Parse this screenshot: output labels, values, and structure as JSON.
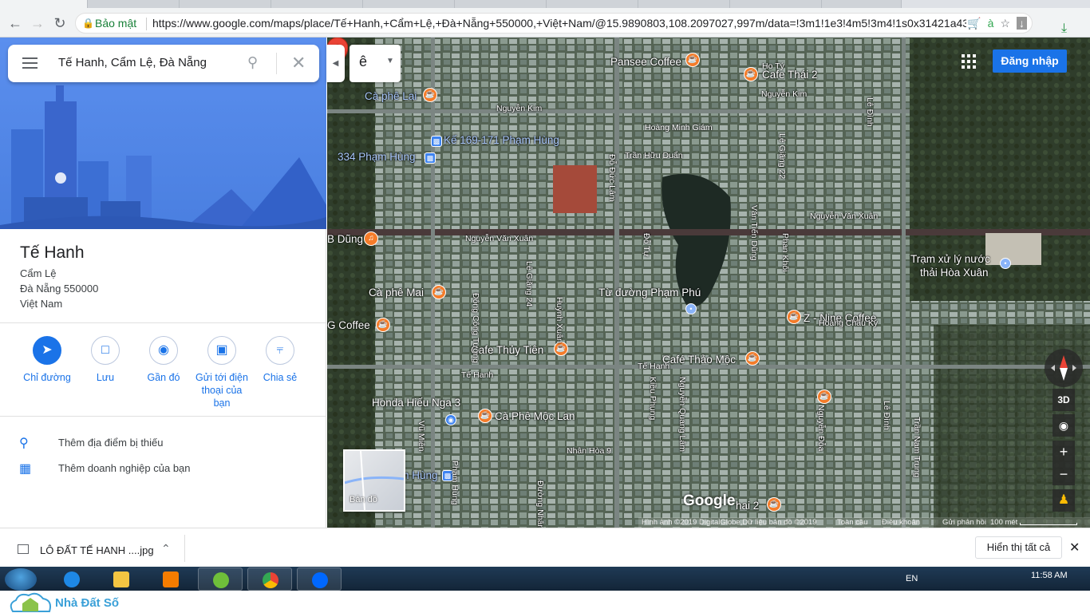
{
  "browser": {
    "secure_label": "Bảo mật",
    "url": "https://www.google.com/maps/place/Tế+Hanh,+Cẩm+Lệ,+Đà+Nẵng+550000,+Việt+Nam/@15.9890803,108.2097027,997m/data=!3m1!1e3!4m5!3m4!1s0x31421a4317"
  },
  "search": {
    "query": "Tế Hanh, Cẩm Lệ, Đà Nẵng"
  },
  "place": {
    "name": "Tế Hanh",
    "address_lines": [
      "Cẩm Lệ",
      "Đà Nẵng 550000",
      "Việt Nam"
    ]
  },
  "actions": [
    {
      "label": "Chỉ đường",
      "icon": "directions-icon"
    },
    {
      "label": "Lưu",
      "icon": "bookmark-icon"
    },
    {
      "label": "Gần đó",
      "icon": "nearby-icon"
    },
    {
      "label": "Gửi tới điện thoại của bạn",
      "icon": "send-to-phone-icon"
    },
    {
      "label": "Chia sẻ",
      "icon": "share-icon"
    }
  ],
  "extras": [
    {
      "label": "Thêm địa điểm bị thiếu",
      "icon": "add-place-icon"
    },
    {
      "label": "Thêm doanh nghiệp của bạn",
      "icon": "add-business-icon"
    }
  ],
  "map": {
    "lang_button": "ê",
    "signin": "Đăng nhập",
    "minimap_label": "Bản đồ",
    "three_d": "3D",
    "logo": "Google",
    "pois": [
      {
        "text": "Pansee Coffee",
        "kind": "food"
      },
      {
        "text": "Cafe Thái 2",
        "kind": "food"
      },
      {
        "text": "Cà phê Lai",
        "kind": "blue"
      },
      {
        "text": "Kế 169-171 Phạm Hùng",
        "kind": "blue"
      },
      {
        "text": "334 Phạm Hùng",
        "kind": "blue"
      },
      {
        "text": "B Dũng",
        "kind": "food"
      },
      {
        "text": "Trạm xử lý nước",
        "kind": "grey"
      },
      {
        "text": "thải Hòa Xuân",
        "kind": "grey"
      },
      {
        "text": "Cà phê Mai",
        "kind": "food"
      },
      {
        "text": "Từ đường Phạm Phú",
        "kind": "grey"
      },
      {
        "text": "Z - Nine Coffee",
        "kind": "food"
      },
      {
        "text": "G Coffee",
        "kind": "food"
      },
      {
        "text": "Cafe Thủy Tiên",
        "kind": "food"
      },
      {
        "text": "Café Thảo Mộc",
        "kind": "food"
      },
      {
        "text": "Honda Hiếu Nga 3",
        "kind": "grey"
      },
      {
        "text": "Cà Phê Mộc Lan",
        "kind": "food"
      },
      {
        "text": "n Hùng",
        "kind": "blue"
      },
      {
        "text": "hai 2",
        "kind": "food"
      }
    ],
    "streets": [
      "Nguyễn Kim",
      "Hoàng Minh Giám",
      "Trần Hữu Duẩn",
      "Nguyễn Kim",
      "Nguyễn Văn Xuân",
      "Nguyễn Văn Xuân",
      "Hoàng Châu Ký",
      "Tế Hanh",
      "Tế Hanh",
      "Nhân Hòa 9",
      "Đỗ Đức Lâm",
      "Lê Giăng 22",
      "Văn Tiến Dũng",
      "Phan Khôi",
      "Lê Đình",
      "Lê Giăng 24",
      "Huỳnh Xuân",
      "Đông Công Tường",
      "Kiều Phụng",
      "Nguyễn Quang Lâm",
      "Nguyễn Đỗa",
      "Lê Đình",
      "Trần Nam Trung",
      "Vũ Miên",
      "Phạm Hùng",
      "Đường Nhân",
      "Ho Tý",
      "Đỗ Tự"
    ],
    "footer": [
      "Hình ảnh ©2019 DigitalGlobe,Dữ liệu bản đồ ©2019",
      "Toàn cầu",
      "Điều khoản",
      "Gửi phản hồi",
      "100 mét"
    ]
  },
  "downloads": {
    "file": "LÔ ĐẤT TẾ HANH ....jpg",
    "show_all": "Hiển thị tất cả"
  },
  "taskbar": {
    "lang": "EN",
    "time": "11:58 AM"
  },
  "watermark": {
    "brand": "Nhà Đất Số"
  },
  "colors": {
    "accent": "#1a73e8",
    "poi_orange": "#f57c2a",
    "marker_red": "#ea4335"
  }
}
